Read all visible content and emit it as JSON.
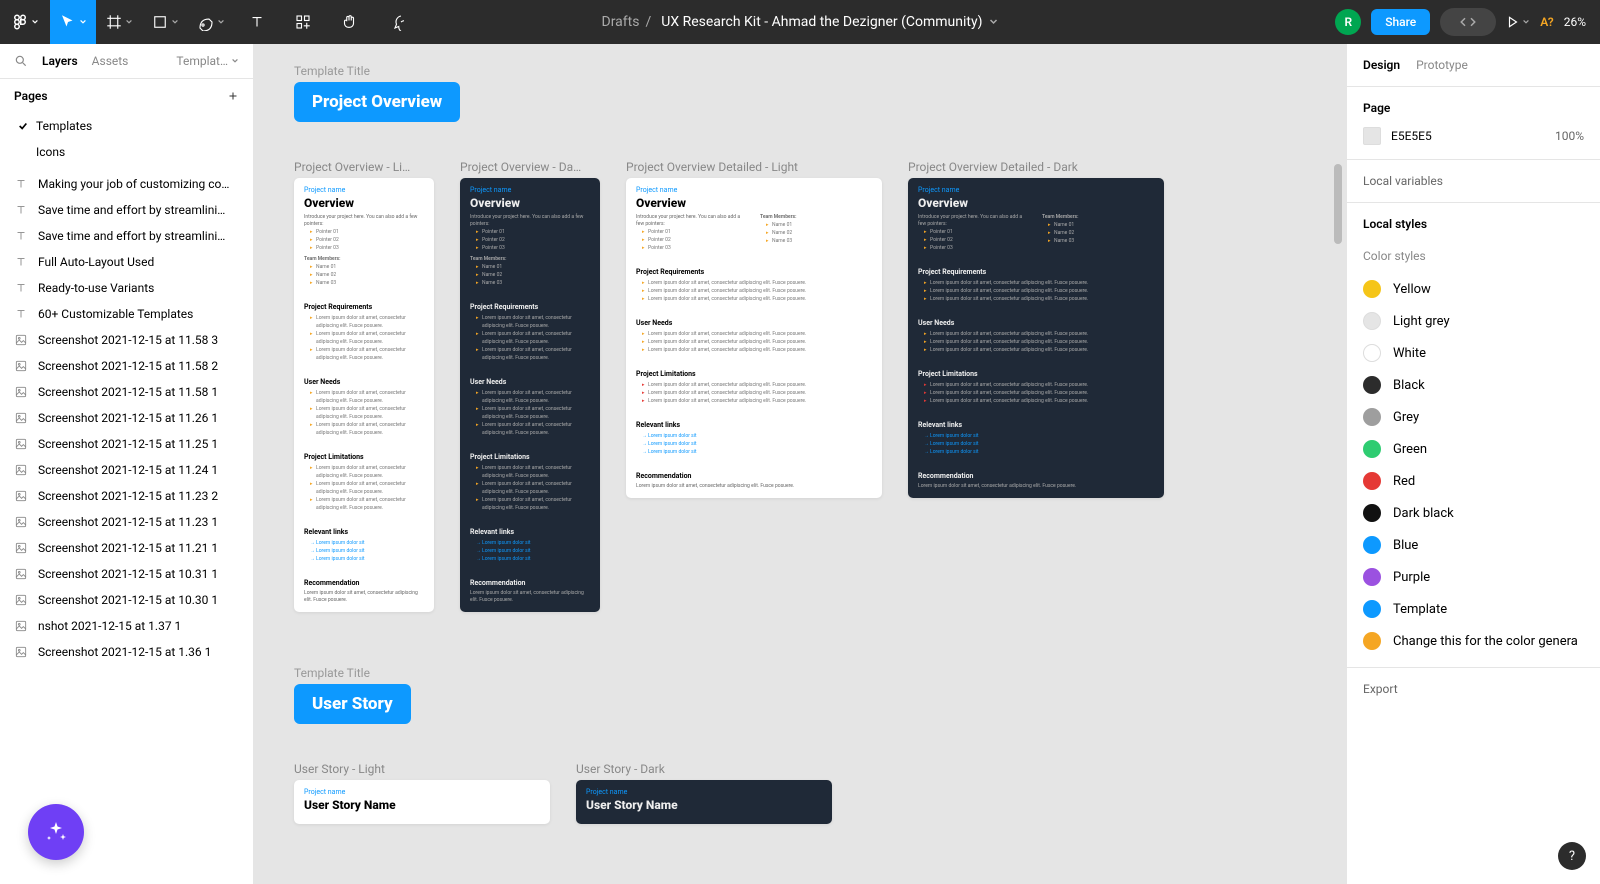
{
  "toolbar": {
    "breadcrumb_root": "Drafts",
    "breadcrumb_sep": "/",
    "filename": "UX Research Kit - Ahmad the Dezigner (Community)",
    "avatar_initial": "R",
    "share_label": "Share",
    "a_badge": "A?",
    "zoom": "26%"
  },
  "left": {
    "tabs": {
      "layers": "Layers",
      "assets": "Assets",
      "templates": "Templat…"
    },
    "pages_label": "Pages",
    "pages": [
      {
        "label": "Templates",
        "selected": true
      },
      {
        "label": "Icons",
        "selected": false
      }
    ],
    "layers": [
      {
        "type": "text",
        "label": "Making your job of customizing co…"
      },
      {
        "type": "text",
        "label": "Save time and effort by streamlini…"
      },
      {
        "type": "text",
        "label": "Save time and effort by streamlini…"
      },
      {
        "type": "text",
        "label": "Full Auto-Layout Used"
      },
      {
        "type": "text",
        "label": "Ready-to-use Variants"
      },
      {
        "type": "text",
        "label": "60+ Customizable Templates"
      },
      {
        "type": "image",
        "label": "Screenshot 2021-12-15 at 11.58 3"
      },
      {
        "type": "image",
        "label": "Screenshot 2021-12-15 at 11.58 2"
      },
      {
        "type": "image",
        "label": "Screenshot 2021-12-15 at 11.58 1"
      },
      {
        "type": "image",
        "label": "Screenshot 2021-12-15 at 11.26 1"
      },
      {
        "type": "image",
        "label": "Screenshot 2021-12-15 at 11.25 1"
      },
      {
        "type": "image",
        "label": "Screenshot 2021-12-15 at 11.24 1"
      },
      {
        "type": "image",
        "label": "Screenshot 2021-12-15 at 11.23 2"
      },
      {
        "type": "image",
        "label": "Screenshot 2021-12-15 at 11.23 1"
      },
      {
        "type": "image",
        "label": "Screenshot 2021-12-15 at 11.21 1"
      },
      {
        "type": "image",
        "label": "Screenshot 2021-12-15 at 10.31 1"
      },
      {
        "type": "image",
        "label": "Screenshot 2021-12-15 at 10.30 1"
      },
      {
        "type": "image",
        "label": "nshot 2021-12-15 at 1.37 1"
      },
      {
        "type": "image",
        "label": "Screenshot 2021-12-15 at 1.36 1"
      }
    ]
  },
  "right": {
    "tabs": {
      "design": "Design",
      "prototype": "Prototype"
    },
    "page_label": "Page",
    "page_color": "E5E5E5",
    "page_opacity": "100%",
    "local_variables": "Local variables",
    "local_styles": "Local styles",
    "color_styles_label": "Color styles",
    "color_styles": [
      {
        "name": "Yellow",
        "hex": "#f5c518"
      },
      {
        "name": "Light grey",
        "hex": "#e5e5e5",
        "bordered": true
      },
      {
        "name": "White",
        "hex": "#ffffff",
        "bordered": true
      },
      {
        "name": "Black",
        "hex": "#2c2c2c"
      },
      {
        "name": "Grey",
        "hex": "#9e9e9e"
      },
      {
        "name": "Green",
        "hex": "#2ecc71"
      },
      {
        "name": "Red",
        "hex": "#e53935"
      },
      {
        "name": "Dark black",
        "hex": "#111111"
      },
      {
        "name": "Blue",
        "hex": "#0d99ff"
      },
      {
        "name": "Purple",
        "hex": "#9b51e0"
      },
      {
        "name": "Template",
        "hex": "#0d99ff"
      },
      {
        "name": "Change this for the color genera",
        "hex": "#f5a623"
      }
    ],
    "export_label": "Export"
  },
  "canvas": {
    "section1": {
      "title_label": "Template Title",
      "title": "Project Overview",
      "frames": [
        {
          "label": "Project Overview - Li…",
          "variant": "light",
          "width": "narrow"
        },
        {
          "label": "Project Overview - Da…",
          "variant": "dark",
          "width": "narrow"
        },
        {
          "label": "Project Overview Detailed - Light",
          "variant": "light",
          "width": "wide"
        },
        {
          "label": "Project Overview Detailed - Dark",
          "variant": "dark",
          "width": "wide"
        }
      ]
    },
    "section2": {
      "title_label": "Template Title",
      "title": "User Story",
      "frames": [
        {
          "label": "User Story - Light",
          "variant": "light",
          "width": "wide"
        },
        {
          "label": "User Story - Dark",
          "variant": "dark",
          "width": "wide"
        }
      ]
    },
    "frame_text": {
      "project_name": "Project name",
      "overview": "Overview",
      "user_story_name": "User Story Name",
      "intro": "Introduce your project here. You can also add a few pointers:",
      "team_members": "Team Members:",
      "pointer": "Pointer 0",
      "name": "Name 0",
      "req": "Project Requirements",
      "needs": "User Needs",
      "limits": "Project Limitations",
      "links": "Relevant links",
      "rec": "Recommendation",
      "lorem": "Lorem ipsum dolor sit amet, consectetur adipiscing elit.",
      "lorem2": "Lorem ipsum dolor sit amet, consectetur adipiscing elit. Fusce posuere.",
      "link_text": "Lorem ipsum dolor sit"
    }
  }
}
